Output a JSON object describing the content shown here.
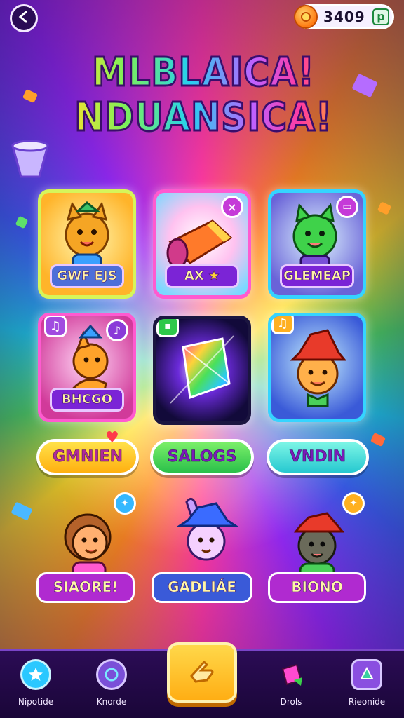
{
  "header": {
    "back_icon": "arrow-left-icon",
    "coin_balance": "3409",
    "coin_plus": "p",
    "title_line1": "MLBLAICA!",
    "title_line2": "NDUANSICA!"
  },
  "cards": [
    {
      "label": "GWF EJS",
      "art": "cat-character",
      "accent": "#ffd54a"
    },
    {
      "label": "AX",
      "art": "horn-item",
      "badge": "×",
      "accent": "#ff5ad0"
    },
    {
      "label": "GLEMEAP",
      "art": "green-cat-character",
      "badge": "▭",
      "accent": "#35d4ff"
    },
    {
      "label": "BHCGO",
      "art": "fox-character",
      "badge": "♫",
      "badge2": "♪",
      "accent": "#ff5ad0"
    },
    {
      "label": "",
      "art": "rainbow-gem",
      "badge": "▪",
      "accent": "#1b1540"
    },
    {
      "label": "",
      "art": "hat-character",
      "badge": "♫",
      "accent": "#35d4ff"
    }
  ],
  "pill_buttons": [
    {
      "label": "GMNIEN"
    },
    {
      "label": "SALOGS"
    },
    {
      "label": "VNDIN"
    }
  ],
  "characters": [
    {
      "name": "SIAORE!"
    },
    {
      "name": "GADLIÁE"
    },
    {
      "name": "BIONO"
    }
  ],
  "bottom_nav": [
    {
      "label": "Nipotide",
      "icon": "star-icon"
    },
    {
      "label": "Knorde",
      "icon": "ring-icon"
    },
    {
      "label": "",
      "icon": "hand-point-icon"
    },
    {
      "label": "Drols",
      "icon": "gem-icon"
    },
    {
      "label": "Rieonide",
      "icon": "shield-icon"
    }
  ]
}
